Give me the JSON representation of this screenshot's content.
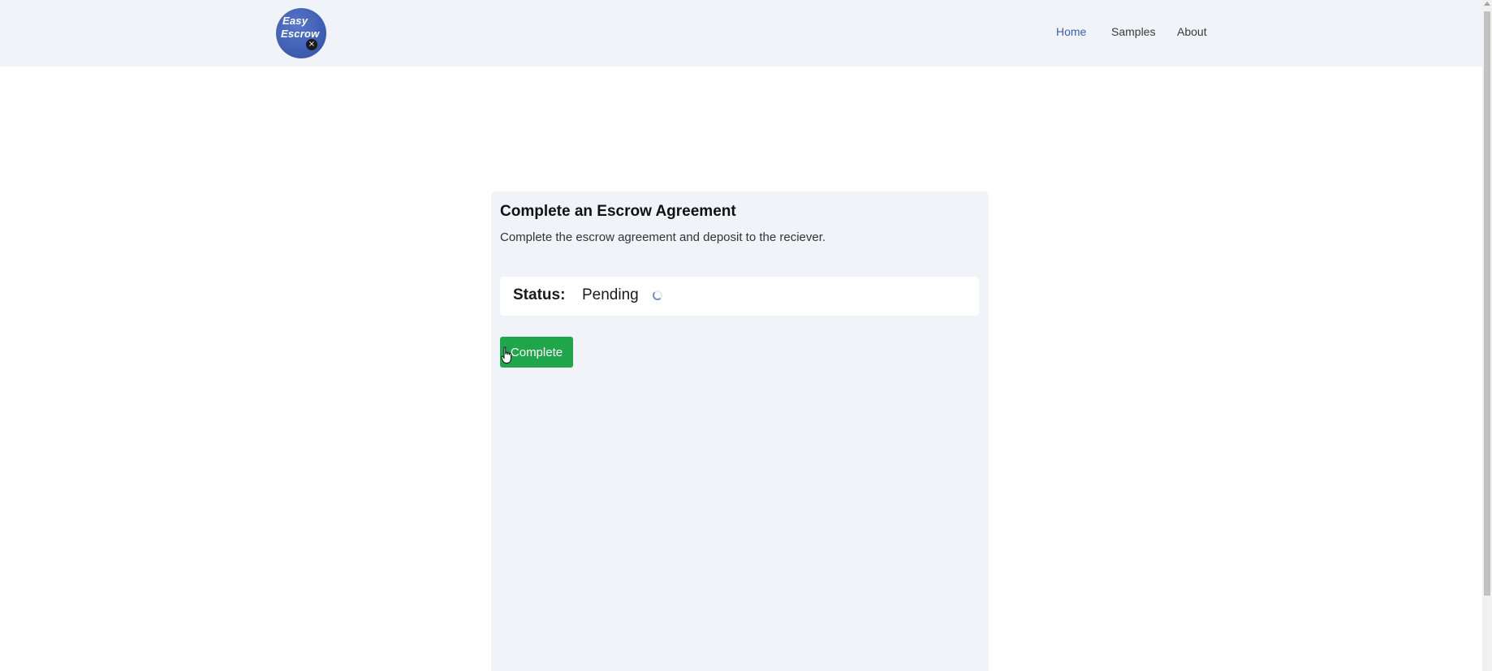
{
  "header": {
    "logo": {
      "line1": "Easy",
      "line2": "Escrow",
      "badge_icon": "close-circle-icon"
    },
    "nav": [
      {
        "label": "Home",
        "active": true
      },
      {
        "label": "Samples",
        "active": false
      },
      {
        "label": "About",
        "active": false
      }
    ]
  },
  "card": {
    "title": "Complete an Escrow Agreement",
    "subtitle": "Complete the escrow agreement and deposit to the reciever.",
    "status": {
      "label": "Status:",
      "value": "Pending",
      "spinner_icon": "loading-spinner-icon"
    },
    "complete_label": "Complete"
  },
  "colors": {
    "header_bg": "#f0f3f8",
    "nav_active": "#3d5fae",
    "button_green": "#1fa64a",
    "card_bg": "#f0f3f8",
    "logo_blue": "#3f5db3"
  }
}
